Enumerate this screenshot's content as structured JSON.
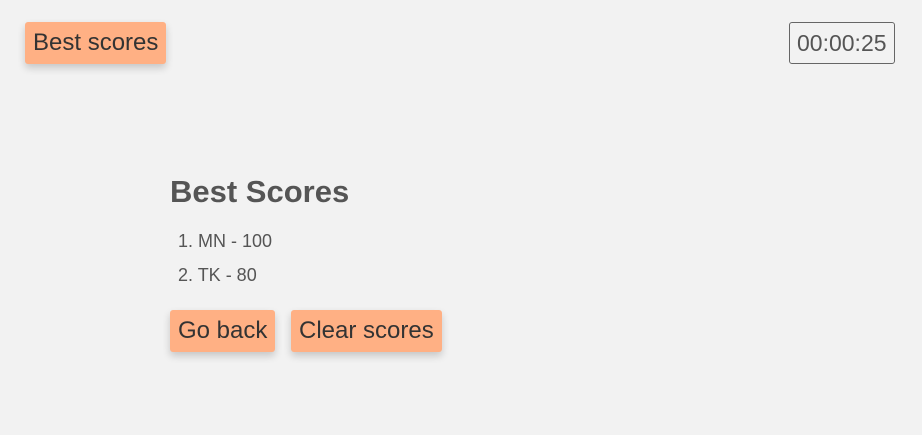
{
  "header": {
    "best_scores_button": "Best scores",
    "timer": "00:00:25"
  },
  "scores_panel": {
    "title": "Best Scores",
    "entries": [
      "1. MN - 100",
      "2. TK - 80"
    ],
    "go_back_button": "Go back",
    "clear_scores_button": "Clear scores"
  },
  "colors": {
    "background": "#f2f2f2",
    "button": "#ffb084",
    "text": "#555555"
  }
}
